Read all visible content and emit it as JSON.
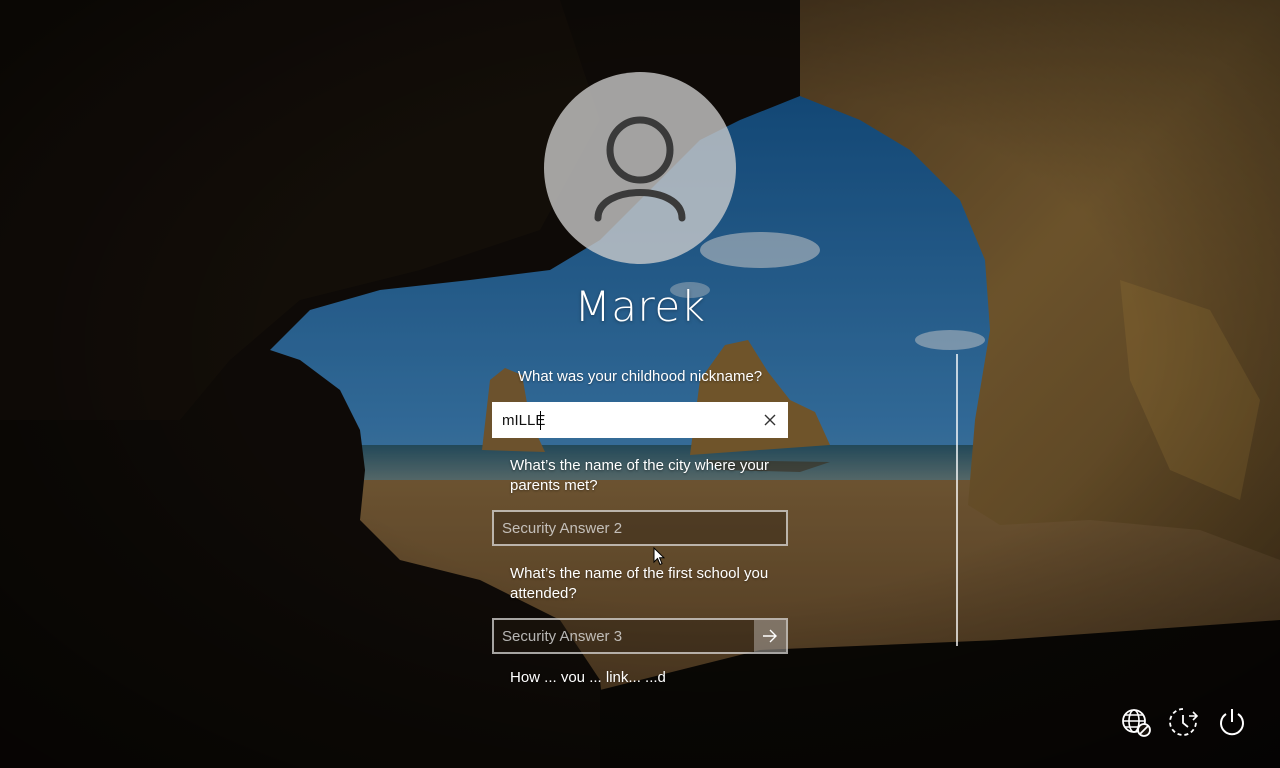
{
  "user": {
    "name": "Marek",
    "avatar_icon": "user-silhouette-icon"
  },
  "security_questions": [
    {
      "question": "What was your childhood nickname?",
      "value": "mILLE",
      "placeholder": ""
    },
    {
      "question": "What’s the name of the city where your parents met?",
      "value": "",
      "placeholder": "Security Answer 2"
    },
    {
      "question": "What’s the name of the first school you attended?",
      "value": "",
      "placeholder": "Security Answer 3"
    },
    {
      "question": "How ... you ... link... ...d"
    }
  ],
  "icons": {
    "clear": "close-icon",
    "submit": "arrow-right-icon",
    "network": "network-globe-icon",
    "ease_of_access": "ease-of-access-icon",
    "power": "power-icon"
  },
  "colors": {
    "text": "#ffffff",
    "field_border": "#bdbdbd",
    "active_field_bg": "#ffffff"
  }
}
